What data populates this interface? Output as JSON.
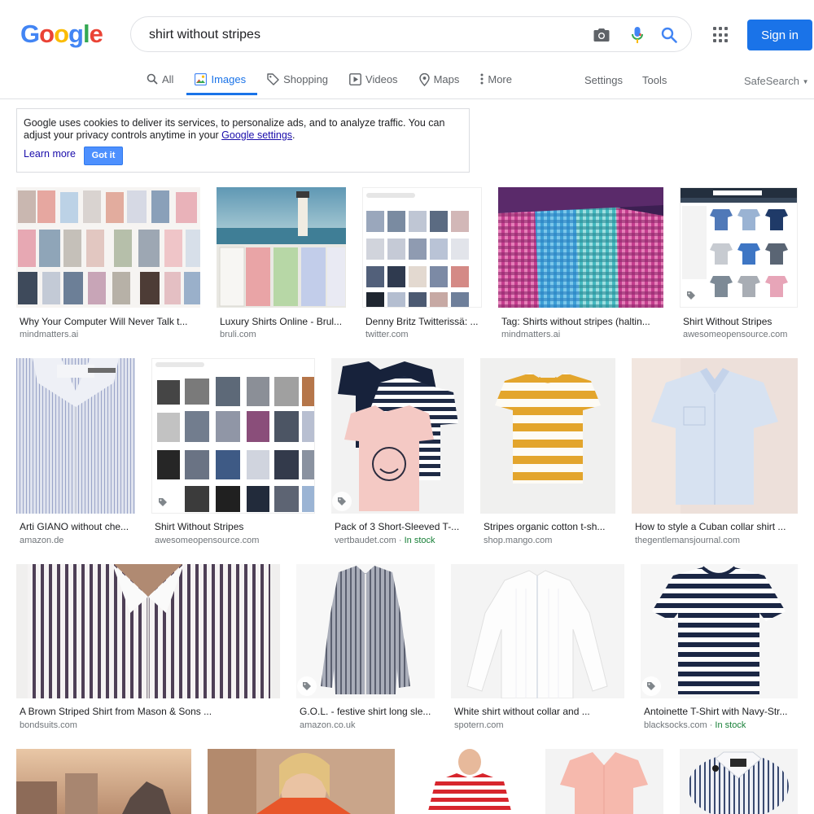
{
  "logo": {
    "letters": [
      "G",
      "o",
      "o",
      "g",
      "l",
      "e"
    ],
    "colors": [
      "#4285f4",
      "#ea4335",
      "#fbbc05",
      "#4285f4",
      "#34a853",
      "#ea4335"
    ]
  },
  "search": {
    "value": "shirt without stripes"
  },
  "header": {
    "signin_label": "Sign in",
    "settings_label": "Settings",
    "tools_label": "Tools",
    "safesearch_label": "SafeSearch"
  },
  "tabs": [
    {
      "label": "All",
      "icon": "search-icon"
    },
    {
      "label": "Images",
      "icon": "image-icon",
      "active": true
    },
    {
      "label": "Shopping",
      "icon": "tag-icon"
    },
    {
      "label": "Videos",
      "icon": "play-icon"
    },
    {
      "label": "Maps",
      "icon": "map-pin-icon"
    },
    {
      "label": "More",
      "icon": "more-vert-icon"
    }
  ],
  "cookie": {
    "text": "Google uses cookies to deliver its services, to personalize ads, and to analyze traffic. You can adjust your privacy controls anytime in your ",
    "link": "Google settings",
    "end": ".",
    "learn_more": "Learn more",
    "got_it": "Got it"
  },
  "results": [
    {
      "title": "Why Your Computer Will Never Talk t...",
      "source": "mindmatters.ai"
    },
    {
      "title": "Luxury Shirts Online - Brul...",
      "source": "bruli.com"
    },
    {
      "title": "Denny Britz Twitterissä: ...",
      "source": "twitter.com"
    },
    {
      "title": "Tag: Shirts without stripes (haltin...",
      "source": "mindmatters.ai"
    },
    {
      "title": "Shirt Without Stripes",
      "source": "awesomeopensource.com"
    },
    {
      "title": "Arti GIANO without che...",
      "source": "amazon.de"
    },
    {
      "title": "Shirt Without Stripes",
      "source": "awesomeopensource.com"
    },
    {
      "title": "Pack of 3 Short-Sleeved T-...",
      "source": "vertbaudet.com",
      "stock": "In stock"
    },
    {
      "title": "Stripes organic cotton t-sh...",
      "source": "shop.mango.com"
    },
    {
      "title": "How to style a Cuban collar shirt ...",
      "source": "thegentlemansjournal.com"
    },
    {
      "title": "A Brown Striped Shirt from Mason & Sons ...",
      "source": "bondsuits.com"
    },
    {
      "title": "G.O.L. - festive shirt long sle...",
      "source": "amazon.co.uk"
    },
    {
      "title": "White shirt without collar and ...",
      "source": "spotern.com"
    },
    {
      "title": "Antoinette T-Shirt with Navy-Str...",
      "source": "blacksocks.com",
      "stock": "In stock"
    }
  ],
  "stock_separator": " · "
}
